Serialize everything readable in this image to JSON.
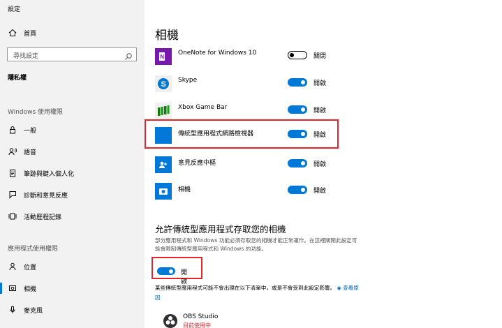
{
  "window": {
    "title": "設定"
  },
  "sidebar": {
    "home": {
      "label": "首頁",
      "icon": "home-icon"
    },
    "search": {
      "placeholder": "尋找設定",
      "icon": "search-icon"
    },
    "category": "隱私權",
    "groups": [
      {
        "heading": "Windows 使用權限",
        "items": [
          {
            "label": "一般",
            "icon": "lock-icon"
          },
          {
            "label": "語音",
            "icon": "speech-icon"
          },
          {
            "label": "筆跡與鍵入個人化",
            "icon": "notepad-icon"
          },
          {
            "label": "診斷和意見反應",
            "icon": "feedback-icon"
          },
          {
            "label": "活動歷程記錄",
            "icon": "timeline-icon"
          }
        ]
      },
      {
        "heading": "應用程式使用權限",
        "items": [
          {
            "label": "位置",
            "icon": "location-icon"
          },
          {
            "label": "相機",
            "icon": "camera-icon",
            "active": true
          },
          {
            "label": "麥克風",
            "icon": "microphone-icon"
          }
        ]
      }
    ]
  },
  "main": {
    "title": "相機",
    "apps": [
      {
        "name": "OneNote for Windows 10",
        "state": "關閉",
        "on": false,
        "icon": "onenote-icon",
        "color": "#7719aa"
      },
      {
        "name": "Skype",
        "state": "開啟",
        "on": true,
        "icon": "skype-icon",
        "color": "#0078d4"
      },
      {
        "name": "Xbox Game Bar",
        "state": "開啟",
        "on": true,
        "icon": "xbox-game-bar-icon",
        "color": "#107c10"
      },
      {
        "name": "傳統型應用程式網路檢視器",
        "state": "開啟",
        "on": true,
        "icon": "webview-icon",
        "color": "#0078d7"
      },
      {
        "name": "意見反應中樞",
        "state": "開啟",
        "on": true,
        "icon": "feedback-hub-icon",
        "color": "#0078d7"
      },
      {
        "name": "相機",
        "state": "開啟",
        "on": true,
        "icon": "camera-app-icon",
        "color": "#0078d7"
      }
    ],
    "desktop_section": {
      "title": "允許傳統型應用程式存取您的相機",
      "description": "部分應用程式和 Windows 功能必須存取您的相機才能正常運作。在這裡關閉此設定可能會限制傳統型應用程式和 Windows 的功能。",
      "toggle_label": "開啟",
      "toggle_on": true,
      "note": "某些傳統型應用程式可能不會出現在以下清單中，或是不會受到此設定影響。",
      "link": "查看原因",
      "apps": [
        {
          "name": "OBS Studio",
          "status": "目前使用中",
          "icon": "obs-icon"
        }
      ]
    }
  },
  "colors": {
    "accent": "#0078d7",
    "highlight": "#e3242b",
    "sidebar_bg": "#f2f2f2"
  }
}
